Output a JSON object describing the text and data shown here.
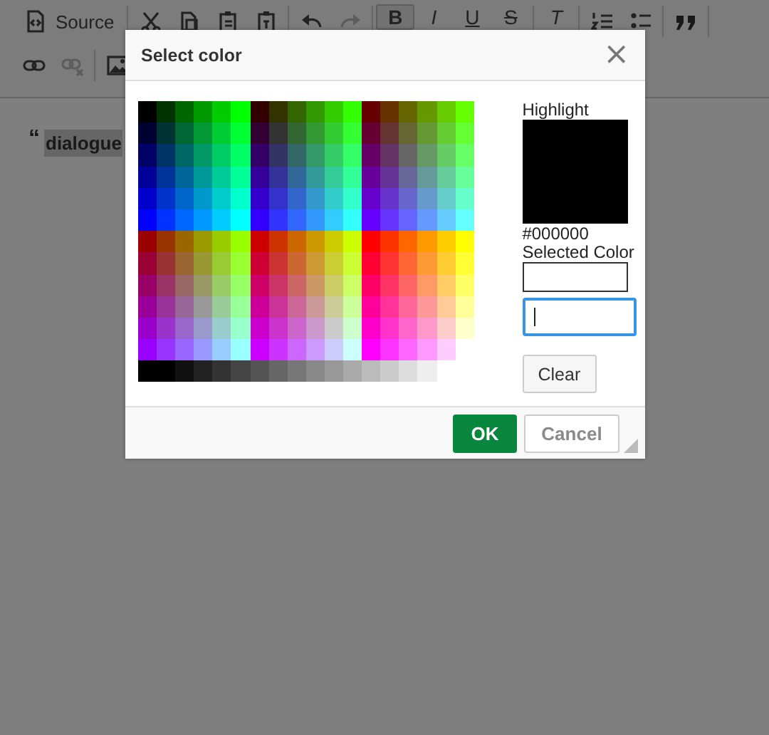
{
  "toolbar": {
    "rows": [
      [
        {
          "kind": "source",
          "label": "Source"
        },
        {
          "kind": "sep"
        },
        {
          "kind": "cut"
        },
        {
          "kind": "copy"
        },
        {
          "kind": "paste"
        },
        {
          "kind": "paste-text"
        },
        {
          "kind": "sep"
        },
        {
          "kind": "undo",
          "disabled": false
        },
        {
          "kind": "redo",
          "disabled": true
        },
        {
          "kind": "sep"
        },
        {
          "kind": "bold",
          "label": "B",
          "on": true
        },
        {
          "kind": "italic",
          "label": "I",
          "on": false
        },
        {
          "kind": "underline",
          "label": "U",
          "on": false
        },
        {
          "kind": "strike",
          "label": "S",
          "on": false
        },
        {
          "kind": "sep"
        },
        {
          "kind": "italic",
          "label": "T",
          "on": false
        },
        {
          "kind": "sep"
        },
        {
          "kind": "numbered-list"
        },
        {
          "kind": "bulleted-list"
        },
        {
          "kind": "sep"
        },
        {
          "kind": "quote"
        },
        {
          "kind": "sep"
        }
      ],
      [
        {
          "kind": "link",
          "disabled": false
        },
        {
          "kind": "unlink",
          "disabled": true
        },
        {
          "kind": "sep"
        },
        {
          "kind": "image"
        }
      ]
    ]
  },
  "content": {
    "quote_mark": "“",
    "text": "dialogue"
  },
  "dialog": {
    "title": "Select color",
    "close": "×",
    "highlight": {
      "label": "Highlight",
      "color": "#000000",
      "value": "#000000"
    },
    "selected": {
      "label": "Selected Color"
    },
    "input": {
      "focused": true
    },
    "clear": "Clear",
    "buttons": [
      {
        "label": "OK",
        "kind": "primary",
        "disabled": false
      },
      {
        "label": "Cancel",
        "kind": "secondary",
        "disabled": true
      }
    ]
  }
}
